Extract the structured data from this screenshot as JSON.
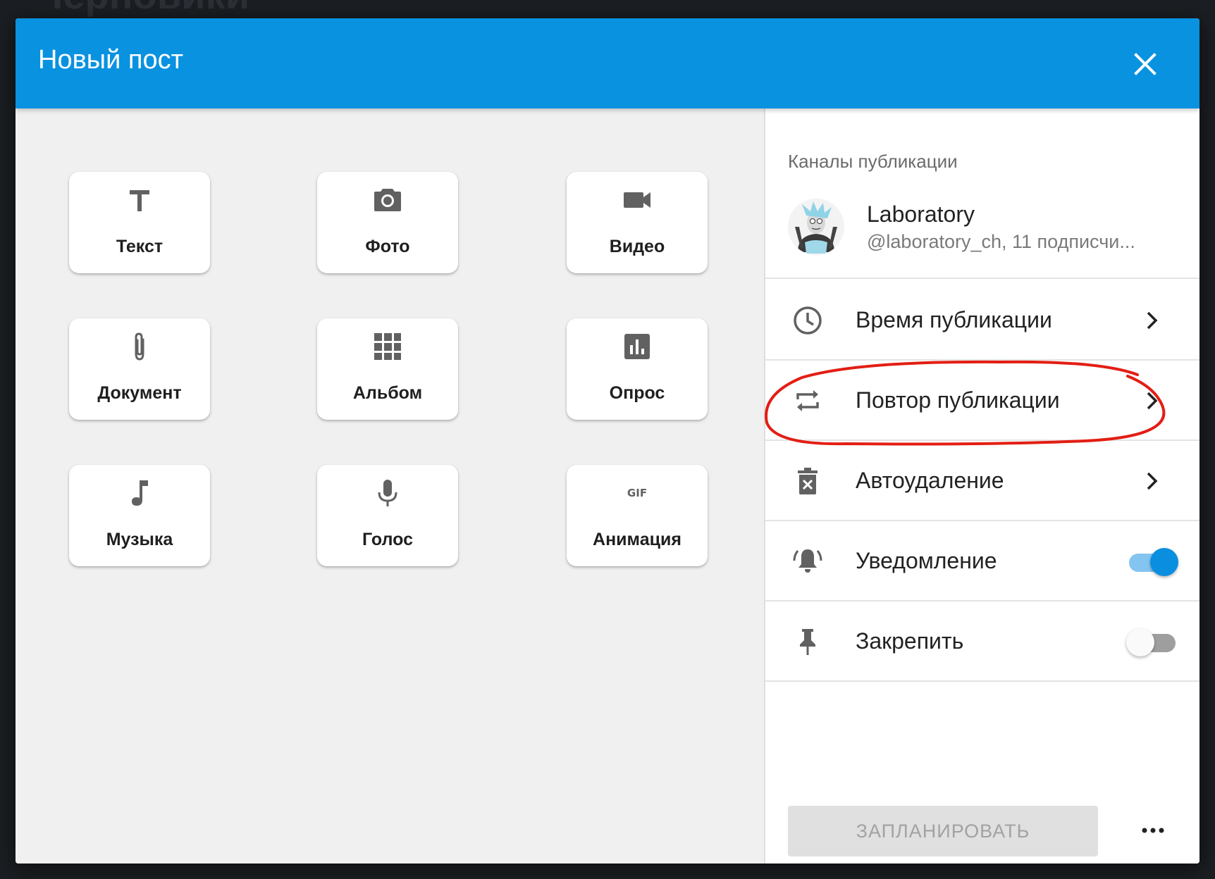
{
  "background": {
    "title_fragment": "Черновики"
  },
  "dialog": {
    "title": "Новый пост",
    "close_icon": "close-icon"
  },
  "post_types": [
    {
      "label": "Текст",
      "icon": "text-icon"
    },
    {
      "label": "Фото",
      "icon": "camera-icon"
    },
    {
      "label": "Видео",
      "icon": "video-icon"
    },
    {
      "label": "Документ",
      "icon": "paperclip-icon"
    },
    {
      "label": "Альбом",
      "icon": "grid-icon"
    },
    {
      "label": "Опрос",
      "icon": "poll-icon"
    },
    {
      "label": "Музыка",
      "icon": "music-note-icon"
    },
    {
      "label": "Голос",
      "icon": "microphone-icon"
    },
    {
      "label": "Анимация",
      "icon": "gif-icon",
      "icon_text": "GIF"
    }
  ],
  "sidebar": {
    "section_title": "Каналы публикации",
    "channel": {
      "name": "Laboratory",
      "subtitle": "@laboratory_ch, 11 подписчи..."
    },
    "settings": [
      {
        "label": "Время публикации",
        "icon": "clock-icon",
        "type": "link"
      },
      {
        "label": "Повтор публикации",
        "icon": "repeat-icon",
        "type": "link"
      },
      {
        "label": "Автоудаление",
        "icon": "delete-timer-icon",
        "type": "link"
      },
      {
        "label": "Уведомление",
        "icon": "bell-icon",
        "type": "toggle",
        "enabled": true
      },
      {
        "label": "Закрепить",
        "icon": "pin-icon",
        "type": "toggle",
        "enabled": false
      }
    ],
    "schedule_button": "ЗАПЛАНИРОВАТЬ",
    "more_icon": "more-horizontal-icon"
  },
  "colors": {
    "header": "#0992e0",
    "accent": "#0a8fe0",
    "annotation": "#e31e14"
  }
}
